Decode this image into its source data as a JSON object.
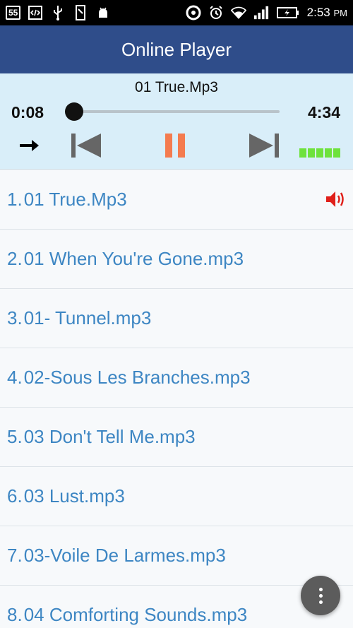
{
  "status_bar": {
    "badge": "55",
    "time": "2:53",
    "ampm": "PM"
  },
  "app": {
    "title": "Online Player"
  },
  "player": {
    "now_playing": "01 True.Mp3",
    "current_time": "0:08",
    "total_time": "4:34",
    "progress_fraction": 0.03
  },
  "playlist": [
    {
      "num": "1.",
      "name": "01 True.Mp3"
    },
    {
      "num": "2.",
      "name": "01 When You're Gone.mp3"
    },
    {
      "num": "3.",
      "name": "01- Tunnel.mp3"
    },
    {
      "num": "4.",
      "name": "02-Sous Les Branches.mp3"
    },
    {
      "num": "5.",
      "name": "03 Don't Tell Me.mp3"
    },
    {
      "num": "6.",
      "name": "03 Lust.mp3"
    },
    {
      "num": "7.",
      "name": "03-Voile De Larmes.mp3"
    },
    {
      "num": "8.",
      "name": "04 Comforting Sounds.mp3"
    }
  ],
  "colors": {
    "app_bar": "#2f4d8a",
    "player_bg": "#d9eef9",
    "track_text": "#3d86c3",
    "pause_accent": "#f47b4f",
    "speaker": "#e0201a",
    "level": "#6ee23c"
  }
}
